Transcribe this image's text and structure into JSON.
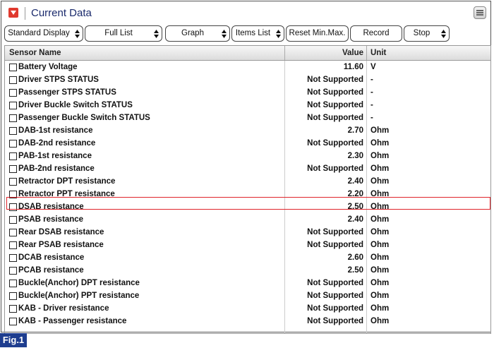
{
  "window": {
    "title": "Current Data"
  },
  "toolbar": {
    "buttons": [
      {
        "label": "Standard Display",
        "dropdown": true
      },
      {
        "label": "Full List",
        "dropdown": true
      },
      {
        "label": "Graph",
        "dropdown": true
      },
      {
        "label": "Items List",
        "dropdown": true
      },
      {
        "label": "Reset Min.Max.",
        "dropdown": false
      },
      {
        "label": "Record",
        "dropdown": false
      },
      {
        "label": "Stop",
        "dropdown": true
      }
    ]
  },
  "table": {
    "columns": [
      "Sensor Name",
      "Value",
      "Unit"
    ],
    "rows": [
      {
        "name": "Battery Voltage",
        "value": "11.60",
        "unit": "V"
      },
      {
        "name": "Driver STPS STATUS",
        "value": "Not Supported",
        "unit": "-"
      },
      {
        "name": "Passenger STPS STATUS",
        "value": "Not Supported",
        "unit": "-"
      },
      {
        "name": "Driver Buckle Switch STATUS",
        "value": "Not Supported",
        "unit": "-"
      },
      {
        "name": "Passenger Buckle Switch STATUS",
        "value": "Not Supported",
        "unit": "-"
      },
      {
        "name": "DAB-1st resistance",
        "value": "2.70",
        "unit": "Ohm"
      },
      {
        "name": "DAB-2nd resistance",
        "value": "Not Supported",
        "unit": "Ohm"
      },
      {
        "name": "PAB-1st resistance",
        "value": "2.30",
        "unit": "Ohm"
      },
      {
        "name": "PAB-2nd resistance",
        "value": "Not Supported",
        "unit": "Ohm"
      },
      {
        "name": "Retractor DPT resistance",
        "value": "2.40",
        "unit": "Ohm"
      },
      {
        "name": "Retractor PPT resistance",
        "value": "2.20",
        "unit": "Ohm"
      },
      {
        "name": "DSAB resistance",
        "value": "2.50",
        "unit": "Ohm"
      },
      {
        "name": "PSAB resistance",
        "value": "2.40",
        "unit": "Ohm"
      },
      {
        "name": "Rear DSAB resistance",
        "value": "Not Supported",
        "unit": "Ohm"
      },
      {
        "name": "Rear PSAB resistance",
        "value": "Not Supported",
        "unit": "Ohm"
      },
      {
        "name": "DCAB resistance",
        "value": "2.60",
        "unit": "Ohm"
      },
      {
        "name": "PCAB resistance",
        "value": "2.50",
        "unit": "Ohm"
      },
      {
        "name": "Buckle(Anchor) DPT resistance",
        "value": "Not Supported",
        "unit": "Ohm"
      },
      {
        "name": "Buckle(Anchor) PPT resistance",
        "value": "Not Supported",
        "unit": "Ohm"
      },
      {
        "name": "KAB - Driver resistance",
        "value": "Not Supported",
        "unit": "Ohm"
      },
      {
        "name": "KAB - Passenger resistance",
        "value": "Not Supported",
        "unit": "Ohm"
      }
    ]
  },
  "figure_label": "Fig.1",
  "colors": {
    "highlight": "#e0252b",
    "title_text": "#1a2a6c",
    "fig_badge": "#1e3d8f",
    "dropdown_icon": "#e03a2f"
  },
  "icons": [
    "dropdown-icon",
    "menu-list-icon",
    "updown-arrow-icon",
    "checkbox-icon"
  ]
}
